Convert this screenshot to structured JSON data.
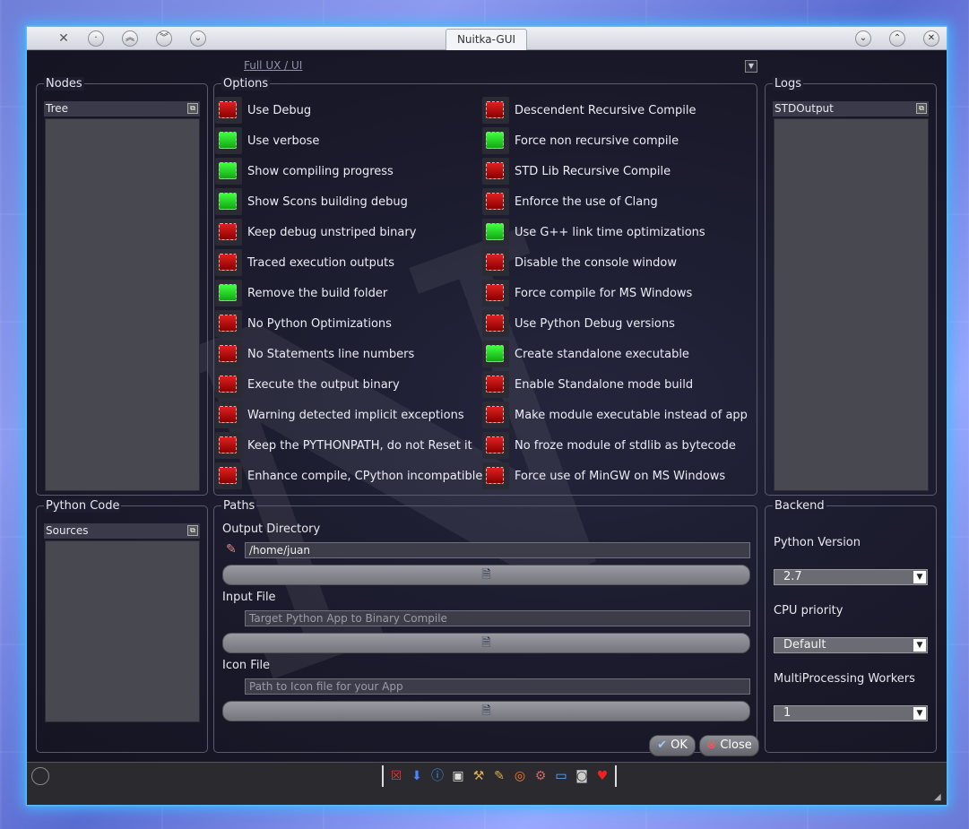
{
  "window": {
    "title": "Nuitka-GUI"
  },
  "titlebar": {
    "left_buttons": [
      "close-x-icon",
      "dot-icon",
      "double-up-icon",
      "double-down-icon",
      "minimize-line-icon"
    ],
    "right_buttons": [
      "chevron-down-icon",
      "chevron-up-icon",
      "close-icon"
    ]
  },
  "toolbar": {
    "full_ux_link": "Full UX / UI"
  },
  "nodes": {
    "group_title": "Nodes",
    "dock_title": "Tree"
  },
  "options": {
    "group_title": "Options",
    "left": [
      {
        "label": "Use Debug",
        "checked": false
      },
      {
        "label": "Use verbose",
        "checked": true
      },
      {
        "label": "Show compiling progress",
        "checked": true
      },
      {
        "label": "Show Scons building debug",
        "checked": true
      },
      {
        "label": "Keep debug unstriped binary",
        "checked": false
      },
      {
        "label": "Traced execution outputs",
        "checked": false
      },
      {
        "label": "Remove the build folder",
        "checked": true
      },
      {
        "label": "No Python Optimizations",
        "checked": false
      },
      {
        "label": "No Statements line numbers",
        "checked": false
      },
      {
        "label": "Execute the output binary",
        "checked": false
      },
      {
        "label": "Warning detected implicit exceptions",
        "checked": false
      },
      {
        "label": "Keep the PYTHONPATH, do not Reset it",
        "checked": false
      },
      {
        "label": "Enhance compile, CPython incompatible",
        "checked": false
      }
    ],
    "right": [
      {
        "label": "Descendent Recursive Compile",
        "checked": false
      },
      {
        "label": "Force non recursive compile",
        "checked": true
      },
      {
        "label": "STD Lib Recursive Compile",
        "checked": false
      },
      {
        "label": "Enforce the use of Clang",
        "checked": false
      },
      {
        "label": "Use G++ link time optimizations",
        "checked": true
      },
      {
        "label": "Disable the console window",
        "checked": false
      },
      {
        "label": "Force compile for MS Windows",
        "checked": false
      },
      {
        "label": "Use Python Debug versions",
        "checked": false
      },
      {
        "label": "Create standalone executable",
        "checked": true
      },
      {
        "label": "Enable Standalone mode build",
        "checked": false
      },
      {
        "label": "Make module executable instead of app",
        "checked": false
      },
      {
        "label": "No froze module of stdlib as bytecode",
        "checked": false
      },
      {
        "label": "Force use of MinGW on MS Windows",
        "checked": false
      }
    ]
  },
  "logs": {
    "group_title": "Logs",
    "dock_title": "STDOutput"
  },
  "python_code": {
    "group_title": "Python Code",
    "dock_title": "Sources"
  },
  "paths": {
    "group_title": "Paths",
    "output_label": "Output Directory",
    "output_value": "/home/juan",
    "input_label": "Input File",
    "input_placeholder": "Target Python App to Binary Compile",
    "icon_label": "Icon File",
    "icon_placeholder": "Path to Icon file for your App"
  },
  "backend": {
    "group_title": "Backend",
    "python_version_label": "Python Version",
    "python_version_value": "2.7",
    "cpu_priority_label": "CPU priority",
    "cpu_priority_value": "Default",
    "workers_label": "MultiProcessing Workers",
    "workers_value": "1"
  },
  "dialog": {
    "ok_label": "OK",
    "close_label": "Close"
  },
  "statusbar": {
    "tray_icons": [
      "close-x-icon",
      "download-arrow-icon",
      "info-icon",
      "terminal-icon",
      "hammer-icon",
      "pen-icon",
      "lifebuoy-icon",
      "gear-icon",
      "folder-icon",
      "camera-icon",
      "heart-icon"
    ]
  },
  "colors": {
    "accent_glow": "#3fb8ff",
    "checked": "#22dd22",
    "unchecked": "#c01010"
  }
}
